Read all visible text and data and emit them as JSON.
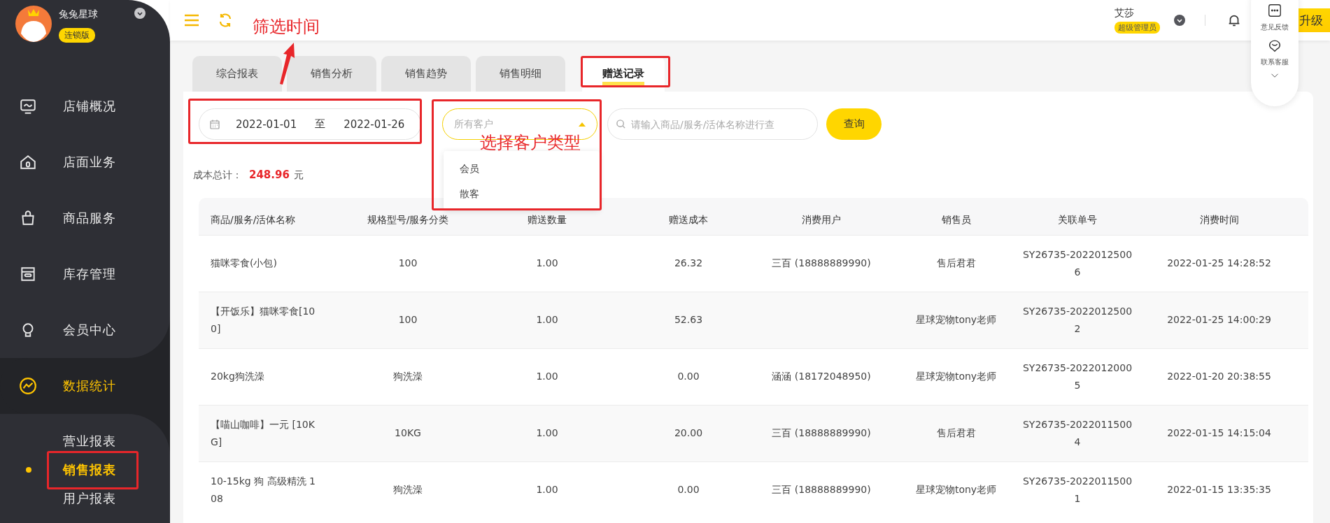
{
  "sidebar": {
    "brand": "兔兔星球",
    "edition": "连锁版",
    "items": [
      {
        "label": "店铺概况",
        "selected": false
      },
      {
        "label": "店面业务",
        "selected": false
      },
      {
        "label": "商品服务",
        "selected": false
      },
      {
        "label": "库存管理",
        "selected": false
      },
      {
        "label": "会员中心",
        "selected": false
      },
      {
        "label": "数据统计",
        "selected": true,
        "children": [
          {
            "label": "营业报表",
            "selected": false
          },
          {
            "label": "销售报表",
            "selected": true
          },
          {
            "label": "用户报表",
            "selected": false
          }
        ]
      }
    ]
  },
  "topbar": {
    "user": "艾莎",
    "role": "超级管理员",
    "upgrade": "升级"
  },
  "float_panel": {
    "items": [
      "意见反馈",
      "联系客服"
    ]
  },
  "tabs": [
    {
      "label": "综合报表",
      "selected": false
    },
    {
      "label": "销售分析",
      "selected": false
    },
    {
      "label": "销售趋势",
      "selected": false
    },
    {
      "label": "销售明细",
      "selected": false
    },
    {
      "label": "赠送记录",
      "selected": true
    }
  ],
  "filters": {
    "date_from": "2022-01-01",
    "date_sep": "至",
    "date_to": "2022-01-26",
    "customer_placeholder": "所有客户",
    "customer_expanded": true,
    "customer_options": [
      "会员",
      "散客"
    ],
    "search_placeholder": "请输入商品/服务/活体名称进行查",
    "query_button": "查询"
  },
  "summary": {
    "label": "成本总计：",
    "value": "248.96",
    "unit": "元"
  },
  "table": {
    "columns": [
      "商品/服务/活体名称",
      "规格型号/服务分类",
      "赠送数量",
      "赠送成本",
      "消费用户",
      "销售员",
      "关联单号",
      "消费时间"
    ],
    "rows": [
      {
        "name": "猫咪零食(小包)",
        "spec": "100",
        "quantity": "1.00",
        "cost": "26.32",
        "customer": "三百 (18888889990)",
        "salesperson": "售后君君",
        "order_no": "SY26735-20220125006",
        "time": "2022-01-25 14:28:52"
      },
      {
        "name": "【开饭乐】猫咪零食[100]",
        "spec": "100",
        "quantity": "1.00",
        "cost": "52.63",
        "salesperson": "星球宠物tony老师",
        "order_no": "SY26735-20220125002",
        "time": "2022-01-25 14:00:29"
      },
      {
        "name": "20kg狗洗澡",
        "spec": "狗洗澡",
        "quantity": "1.00",
        "cost": "0.00",
        "customer": "涵涵 (18172048950)",
        "salesperson": "星球宠物tony老师",
        "order_no": "SY26735-20220120005",
        "time": "2022-01-20 20:38:55"
      },
      {
        "name": "【喵山咖啡】一元 [10KG]",
        "spec": "10KG",
        "quantity": "1.00",
        "cost": "20.00",
        "customer": "三百 (18888889990)",
        "salesperson": "售后君君",
        "order_no": "SY26735-20220115004",
        "time": "2022-01-15 14:15:04"
      },
      {
        "name": "10-15kg 狗 高级精洗 108",
        "spec": "狗洗澡",
        "quantity": "1.00",
        "cost": "0.00",
        "customer": "三百 (18888889990)",
        "salesperson": "星球宠物tony老师",
        "order_no": "SY26735-20220115001",
        "time": "2022-01-15 13:35:35"
      }
    ]
  },
  "annotations": [
    {
      "text": "筛选时间"
    },
    {
      "text": "选择客户类型"
    }
  ]
}
